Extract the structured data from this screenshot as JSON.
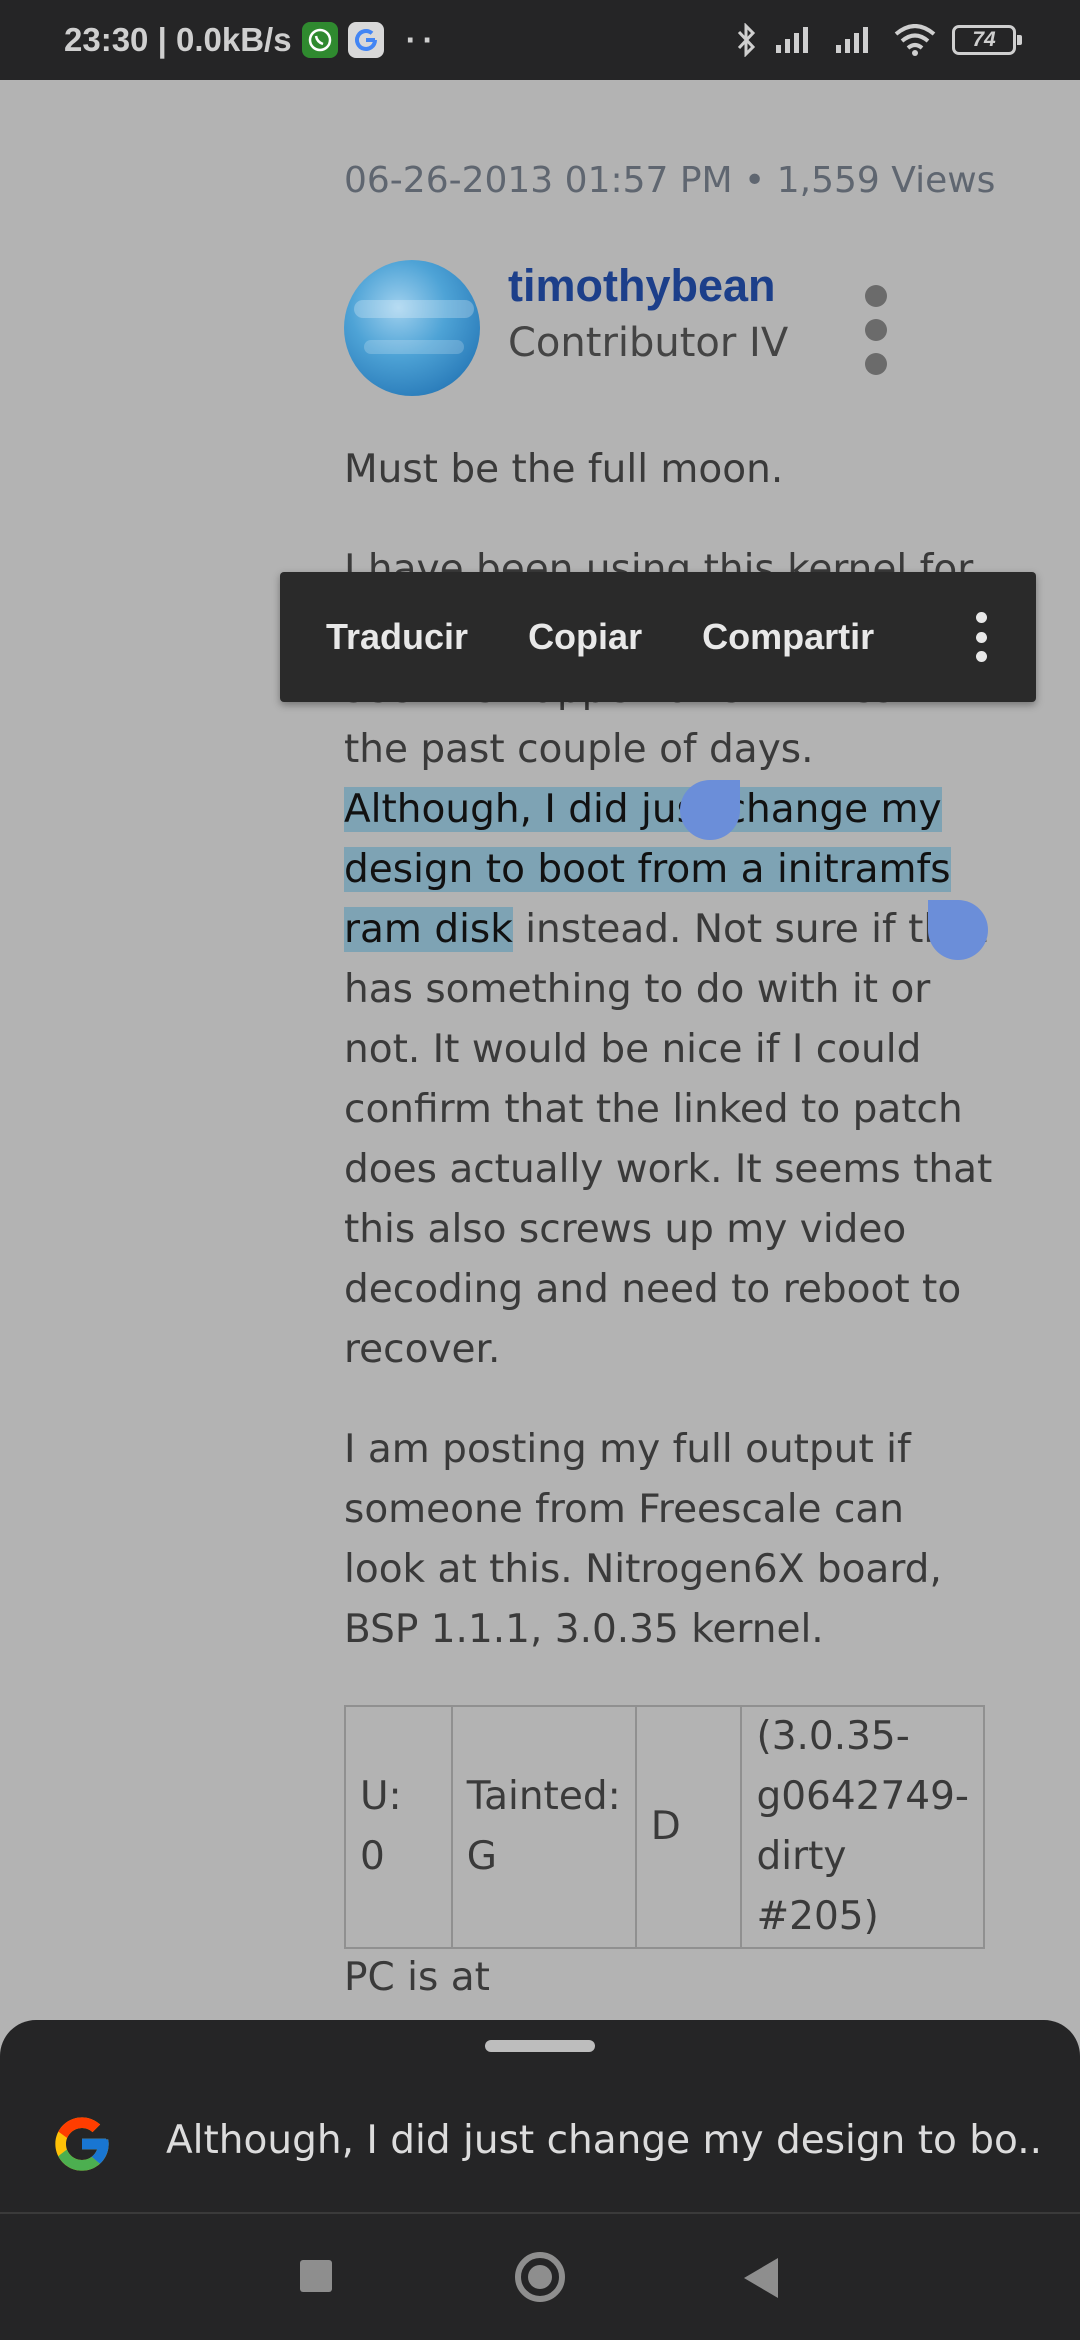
{
  "status_bar": {
    "time_speed": "23:30 | 0.0kB/s",
    "dots": "··",
    "battery": "74"
  },
  "post": {
    "meta": "06-26-2013 01:57 PM • 1,559 Views",
    "author": {
      "name": "timothybean",
      "rank": "Contributor IV"
    },
    "paragraph1": "Must be the full moon.",
    "paragraph2": {
      "before": "I have been using this kernel for a while now and just started to see this happen a few times in the past couple of days. ",
      "selected": "Although, I did just change my design to boot from a initramfs ram disk",
      "after": " instead. Not sure if that has something to do with it or not. It would be nice if I could confirm that the linked to patch does actually work. It seems that this also screws up my video decoding and need to reboot to recover."
    },
    "paragraph3": "I am posting my full output if someone from Freescale can look at this. Nitrogen6X board, BSP 1.1.1, 3.0.35 kernel.",
    "table": {
      "cells": [
        "U: 0",
        "Tainted: G",
        "D",
        "(3.0.35-g0642749-dirty #205)"
      ]
    },
    "after_table": "PC is at"
  },
  "toolbar": {
    "translate": "Traducir",
    "copy": "Copiar",
    "share": "Compartir"
  },
  "sheet": {
    "text": "Although, I did just change my design to bo..."
  },
  "colors": {
    "accent": "#1c3f8a",
    "selection": "#7ea3b4",
    "handle": "#6b8ed9"
  }
}
